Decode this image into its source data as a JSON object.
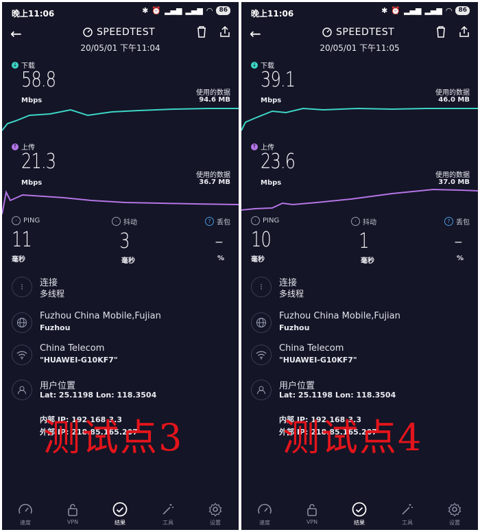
{
  "labels": {
    "brand": "SPEEDTEST",
    "download": "下载",
    "upload": "上传",
    "mbps": "Mbps",
    "data_used": "使用的数据",
    "ping": "PING",
    "jitter": "抖动",
    "loss": "丢包",
    "ms": "毫秒",
    "percent": "%",
    "connection": "连接",
    "user_location": "用户位置",
    "internal_ip_prefix": "内部 IP:",
    "external_ip_prefix": "外部 IP:"
  },
  "tabs": [
    "速度",
    "VPN",
    "结果",
    "工具",
    "设置"
  ],
  "colors": {
    "download": "#3dd6c7",
    "upload": "#b575e7",
    "watermark": "#e3141b",
    "background": "#141526"
  },
  "panels": [
    {
      "status_time": "晚上11:06",
      "battery": "86",
      "datetime": "20/05/01 下午11:04",
      "download": {
        "value": "58.8",
        "data_used": "94.6 MB"
      },
      "upload": {
        "value": "21.3",
        "data_used": "36.7 MB"
      },
      "ping": "11",
      "jitter": "3",
      "loss": "–",
      "connection_type": "多线程",
      "server": "Fuzhou China Mobile,Fujian",
      "server_city": "Fuzhou",
      "isp": "China Telecom",
      "wifi": "\"HUAWEI-G10KF7\"",
      "coords": "Lat: 25.1198 Lon: 118.3504",
      "internal_ip": "192.168.3.3",
      "external_ip": "218.85.165.207",
      "watermark": "测试点3"
    },
    {
      "status_time": "晚上11:06",
      "battery": "86",
      "datetime": "20/05/01 下午11:05",
      "download": {
        "value": "39.1",
        "data_used": "46.0 MB"
      },
      "upload": {
        "value": "23.6",
        "data_used": "37.0 MB"
      },
      "ping": "10",
      "jitter": "1",
      "loss": "–",
      "connection_type": "多线程",
      "server": "Fuzhou China Mobile,Fujian",
      "server_city": "Fuzhou",
      "isp": "China Telecom",
      "wifi": "\"HUAWEI-G10KF7\"",
      "coords": "Lat: 25.1198 Lon: 118.3504",
      "internal_ip": "192.168.3.3",
      "external_ip": "218.85.165.207",
      "watermark": "测试点4"
    }
  ]
}
